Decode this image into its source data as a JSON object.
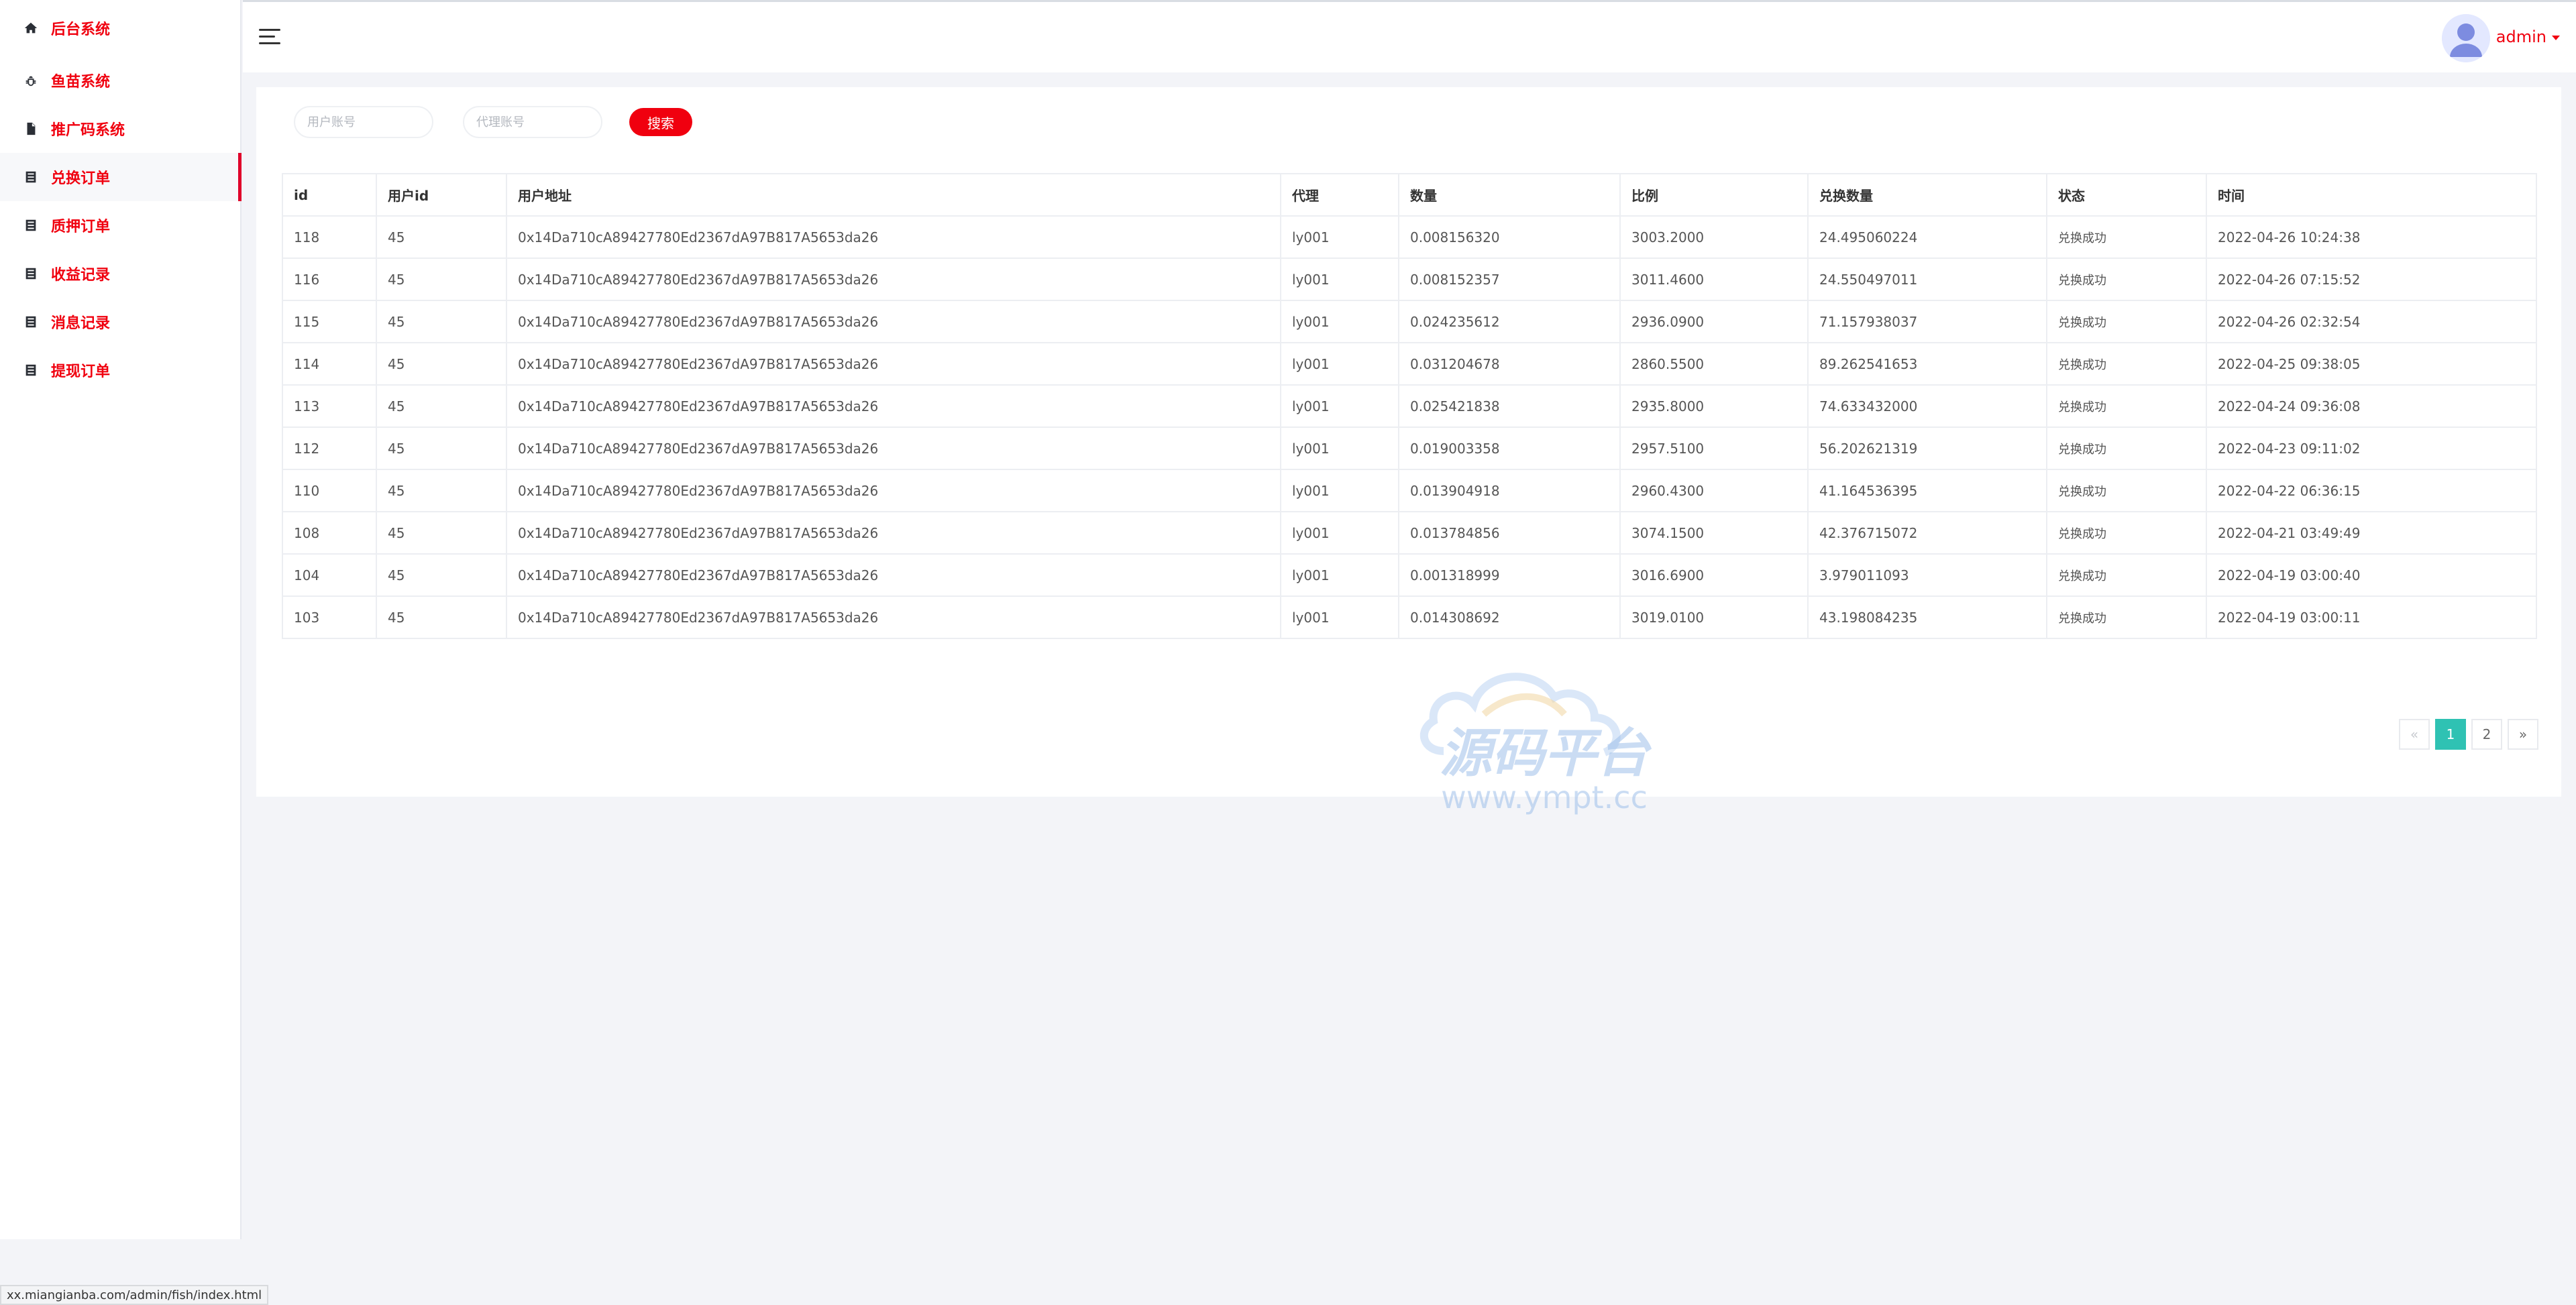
{
  "sidebar": {
    "items": [
      {
        "label": "后台系统",
        "icon": "home-icon"
      },
      {
        "label": "鱼苗系统",
        "icon": "bug-icon"
      },
      {
        "label": "推广码系统",
        "icon": "document-icon"
      },
      {
        "label": "兑换订单",
        "icon": "list-icon",
        "active": true
      },
      {
        "label": "质押订单",
        "icon": "list-icon"
      },
      {
        "label": "收益记录",
        "icon": "list-icon"
      },
      {
        "label": "消息记录",
        "icon": "list-icon"
      },
      {
        "label": "提现订单",
        "icon": "list-icon"
      }
    ]
  },
  "header": {
    "menu_icon": "hamburger-menu-icon",
    "avatar_icon": "user-avatar-icon",
    "username": "admin"
  },
  "search": {
    "user_placeholder": "用户账号",
    "agent_placeholder": "代理账号",
    "button_label": "搜索"
  },
  "table": {
    "columns": [
      "id",
      "用户id",
      "用户地址",
      "代理",
      "数量",
      "比例",
      "兑换数量",
      "状态",
      "时间"
    ],
    "rows": [
      [
        "118",
        "45",
        "0x14Da710cA89427780Ed2367dA97B817A5653da26",
        "ly001",
        "0.008156320",
        "3003.2000",
        "24.495060224",
        "兑换成功",
        "2022-04-26 10:24:38"
      ],
      [
        "116",
        "45",
        "0x14Da710cA89427780Ed2367dA97B817A5653da26",
        "ly001",
        "0.008152357",
        "3011.4600",
        "24.550497011",
        "兑换成功",
        "2022-04-26 07:15:52"
      ],
      [
        "115",
        "45",
        "0x14Da710cA89427780Ed2367dA97B817A5653da26",
        "ly001",
        "0.024235612",
        "2936.0900",
        "71.157938037",
        "兑换成功",
        "2022-04-26 02:32:54"
      ],
      [
        "114",
        "45",
        "0x14Da710cA89427780Ed2367dA97B817A5653da26",
        "ly001",
        "0.031204678",
        "2860.5500",
        "89.262541653",
        "兑换成功",
        "2022-04-25 09:38:05"
      ],
      [
        "113",
        "45",
        "0x14Da710cA89427780Ed2367dA97B817A5653da26",
        "ly001",
        "0.025421838",
        "2935.8000",
        "74.633432000",
        "兑换成功",
        "2022-04-24 09:36:08"
      ],
      [
        "112",
        "45",
        "0x14Da710cA89427780Ed2367dA97B817A5653da26",
        "ly001",
        "0.019003358",
        "2957.5100",
        "56.202621319",
        "兑换成功",
        "2022-04-23 09:11:02"
      ],
      [
        "110",
        "45",
        "0x14Da710cA89427780Ed2367dA97B817A5653da26",
        "ly001",
        "0.013904918",
        "2960.4300",
        "41.164536395",
        "兑换成功",
        "2022-04-22 06:36:15"
      ],
      [
        "108",
        "45",
        "0x14Da710cA89427780Ed2367dA97B817A5653da26",
        "ly001",
        "0.013784856",
        "3074.1500",
        "42.376715072",
        "兑换成功",
        "2022-04-21 03:49:49"
      ],
      [
        "104",
        "45",
        "0x14Da710cA89427780Ed2367dA97B817A5653da26",
        "ly001",
        "0.001318999",
        "3016.6900",
        "3.979011093",
        "兑换成功",
        "2022-04-19 03:00:40"
      ],
      [
        "103",
        "45",
        "0x14Da710cA89427780Ed2367dA97B817A5653da26",
        "ly001",
        "0.014308692",
        "3019.0100",
        "43.198084235",
        "兑换成功",
        "2022-04-19 03:00:11"
      ]
    ]
  },
  "watermark": {
    "title": "源码平台",
    "url": "www.ympt.cc"
  },
  "pagination": {
    "prev": "«",
    "pages": [
      "1",
      "2"
    ],
    "current": "1",
    "next": "»"
  },
  "statusbar": {
    "url": "xx.miangianba.com/admin/fish/index.html"
  },
  "colors": {
    "accent": "#f0000f",
    "page_active": "#2fc2b3"
  }
}
